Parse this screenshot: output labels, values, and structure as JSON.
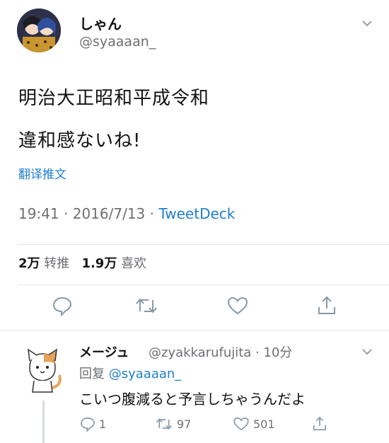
{
  "tweet": {
    "display_name": "しゃん",
    "handle": "@syaaaan_",
    "text_line1": "明治大正昭和平成令和",
    "text_line2": "違和感ないね!",
    "translate": "翻译推文",
    "time": "19:41",
    "date": "2016/7/13",
    "source": "TweetDeck",
    "retweets_count": "2万",
    "retweets_label": "转推",
    "likes_count": "1.9万",
    "likes_label": "喜欢"
  },
  "reply": {
    "display_name": "メージュ",
    "handle": "@zyakkarufujita",
    "time": "10分",
    "replying_label": "回复",
    "replying_to": "@syaaaan_",
    "text": "こいつ腹減ると予言しちゃうんだよ",
    "reply_count": "1",
    "retweet_count": "97",
    "like_count": "501"
  },
  "colors": {
    "link": "#1f7fcf",
    "muted": "#6b6f74",
    "divider": "#e1e6ea"
  },
  "icons": [
    "chevron-down-icon",
    "reply-icon",
    "retweet-icon",
    "like-icon",
    "share-icon"
  ]
}
